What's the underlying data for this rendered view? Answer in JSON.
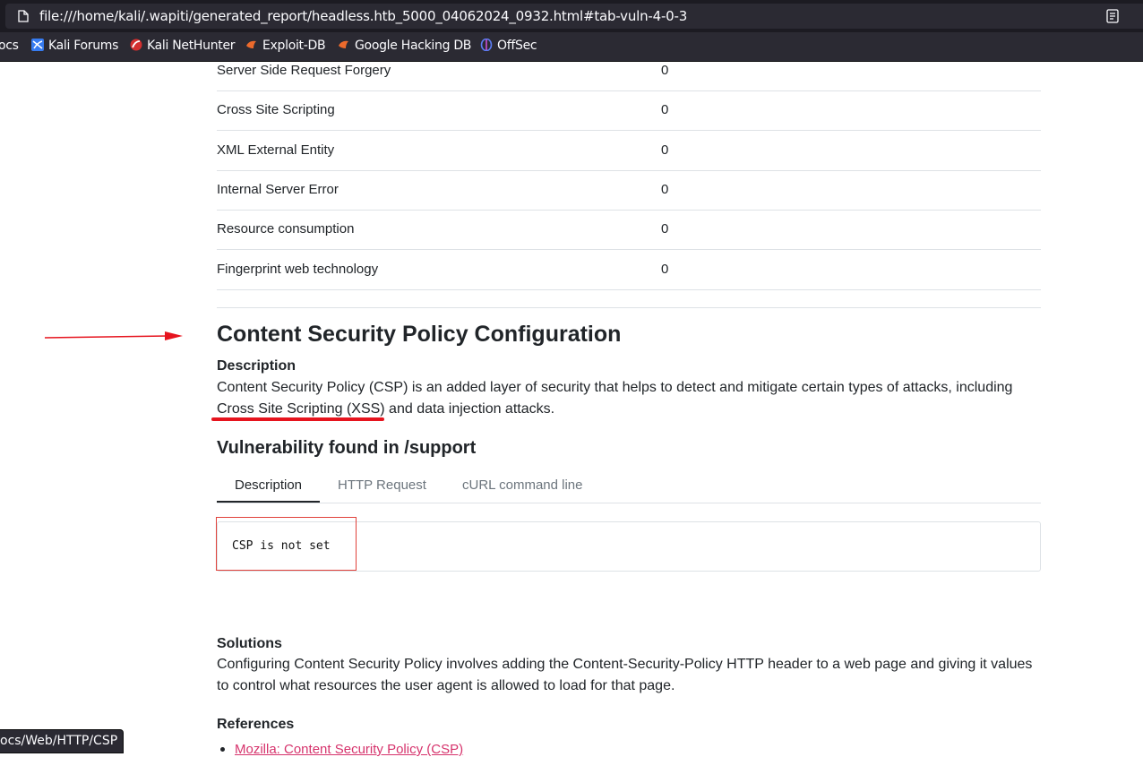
{
  "browser": {
    "url": "file:///home/kali/.wapiti/generated_report/headless.htb_5000_04062024_0932.html#tab-vuln-4-0-3",
    "bookmarks": [
      "ocs",
      "Kali Forums",
      "Kali NetHunter",
      "Exploit-DB",
      "Google Hacking DB",
      "OffSec"
    ],
    "status_url": "ocs/Web/HTTP/CSP",
    "colors": {
      "chrome_bg": "#1c1b22",
      "toolbar_bg": "#2b2a33",
      "text": "#fbfbfe"
    }
  },
  "summary_rows": [
    {
      "name": "Server Side Request Forgery",
      "count": "0"
    },
    {
      "name": "Cross Site Scripting",
      "count": "0"
    },
    {
      "name": "XML External Entity",
      "count": "0"
    },
    {
      "name": "Internal Server Error",
      "count": "0"
    },
    {
      "name": "Resource consumption",
      "count": "0"
    },
    {
      "name": "Fingerprint web technology",
      "count": "0"
    }
  ],
  "section": {
    "title": "Content Security Policy Configuration",
    "description_heading": "Description",
    "description_line1": "Content Security Policy (CSP) is an added layer of security that helps to detect and mitigate certain types of attacks, including",
    "description_line2": "Cross Site Scripting (XSS) and data injection attacks.",
    "vuln_heading": "Vulnerability found in /support",
    "tabs": [
      "Description",
      "HTTP Request",
      "cURL command line"
    ],
    "active_tab": "Description",
    "code": "CSP is not set",
    "solutions_heading": "Solutions",
    "solutions_line1": "Configuring Content Security Policy involves adding the Content-Security-Policy HTTP header to a web page and giving it values",
    "solutions_line2": "to control what resources the user agent is allowed to load for that page.",
    "references_heading": "References",
    "reference_link": "Mozilla: Content Security Policy (CSP)"
  },
  "annotation_color": "#e6141e"
}
